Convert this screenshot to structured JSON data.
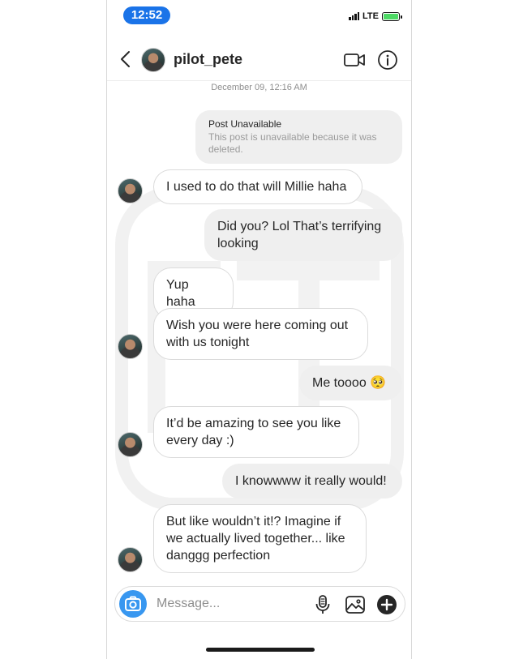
{
  "status_bar": {
    "time": "12:52",
    "network": "LTE"
  },
  "header": {
    "username": "pilot_pete"
  },
  "conversation": {
    "date_label": "December 09, 12:16 AM",
    "post_card": {
      "title": "Post Unavailable",
      "description": "This post is unavailable because it was deleted."
    },
    "messages": [
      {
        "direction": "in",
        "text": "I used to do that will Millie haha"
      },
      {
        "direction": "out",
        "text": "Did you? Lol That’s terrifying looking"
      },
      {
        "direction": "in",
        "text": "Yup haha"
      },
      {
        "direction": "in",
        "text": "Wish you were here coming out with us tonight"
      },
      {
        "direction": "out",
        "text": "Me toooo 🥺"
      },
      {
        "direction": "in",
        "text": "It’d be amazing to see you like every day :)"
      },
      {
        "direction": "out",
        "text": "I knowwww it really would!"
      },
      {
        "direction": "in",
        "text": "But like wouldn’t it!? Imagine if we actually lived together... like danggg perfection"
      }
    ]
  },
  "composer": {
    "placeholder": "Message..."
  },
  "icons": {
    "back": "chevron-left-icon",
    "video": "video-camera-icon",
    "info": "info-icon",
    "camera": "camera-icon",
    "mic": "microphone-icon",
    "gallery": "gallery-icon",
    "add": "plus-icon"
  },
  "colors": {
    "accent": "#3897f0",
    "time_pill": "#1a73e8",
    "outgoing_bubble": "#efefef",
    "incoming_border": "#dbdbdb",
    "battery": "#4cd964"
  }
}
